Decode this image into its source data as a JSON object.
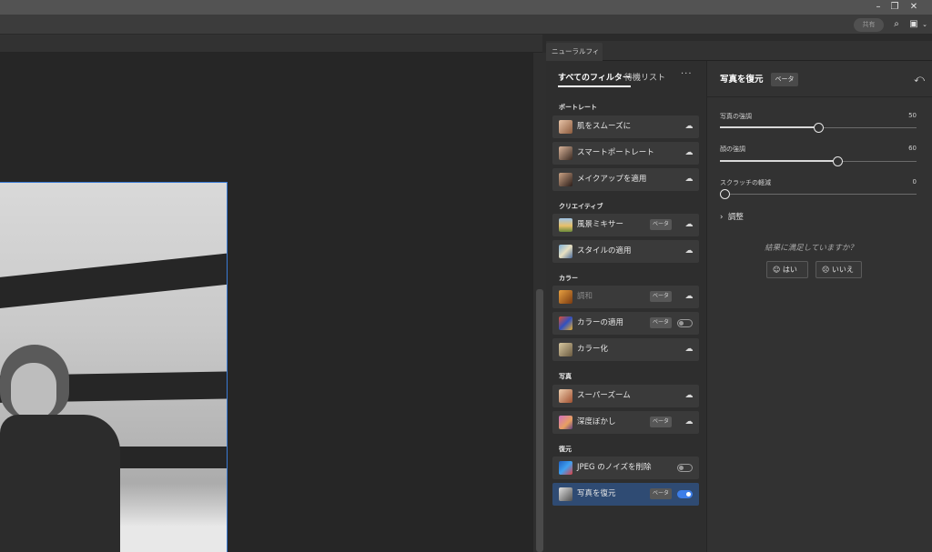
{
  "window": {
    "controls": [
      "minimize-icon",
      "restore-icon",
      "close-icon"
    ]
  },
  "toolbar": {
    "share_label": "共有",
    "icons": [
      "search-icon",
      "panel-layout-icon",
      "chevron-down-icon"
    ]
  },
  "panel": {
    "tab_title": "ニューラルフィルター"
  },
  "filters": {
    "tab_all": "すべてのフィルター",
    "tab_wait": "待機リスト",
    "more": "···",
    "beta_label": "ベータ",
    "sections": [
      {
        "label": "ポートレート",
        "items": [
          {
            "label": "肌をスムーズに",
            "beta": false,
            "control": "cloud"
          },
          {
            "label": "スマートポートレート",
            "beta": false,
            "control": "cloud"
          },
          {
            "label": "メイクアップを適用",
            "beta": false,
            "control": "cloud"
          }
        ]
      },
      {
        "label": "クリエイティブ",
        "items": [
          {
            "label": "風景ミキサー",
            "beta": true,
            "control": "cloud"
          },
          {
            "label": "スタイルの適用",
            "beta": false,
            "control": "cloud"
          }
        ]
      },
      {
        "label": "カラー",
        "items": [
          {
            "label": "調和",
            "beta": true,
            "control": "cloud",
            "dim": true
          },
          {
            "label": "カラーの適用",
            "beta": true,
            "control": "toggle-off"
          },
          {
            "label": "カラー化",
            "beta": false,
            "control": "cloud"
          }
        ]
      },
      {
        "label": "写真",
        "items": [
          {
            "label": "スーパーズーム",
            "beta": false,
            "control": "cloud"
          },
          {
            "label": "深度ぼかし",
            "beta": true,
            "control": "cloud"
          }
        ]
      },
      {
        "label": "復元",
        "items": [
          {
            "label": "JPEG のノイズを削除",
            "beta": false,
            "control": "toggle-off"
          },
          {
            "label": "写真を復元",
            "beta": true,
            "control": "toggle-on",
            "selected": true
          }
        ]
      }
    ]
  },
  "detail": {
    "title": "写真を復元",
    "beta": "ベータ",
    "sliders": [
      {
        "label": "写真の強調",
        "value": 50
      },
      {
        "label": "顔の強調",
        "value": 60
      },
      {
        "label": "スクラッチの軽減",
        "value": 0
      }
    ],
    "adjust_label": "調整",
    "question": "結果に満足していますか？",
    "yes": "はい",
    "no": "いいえ"
  }
}
